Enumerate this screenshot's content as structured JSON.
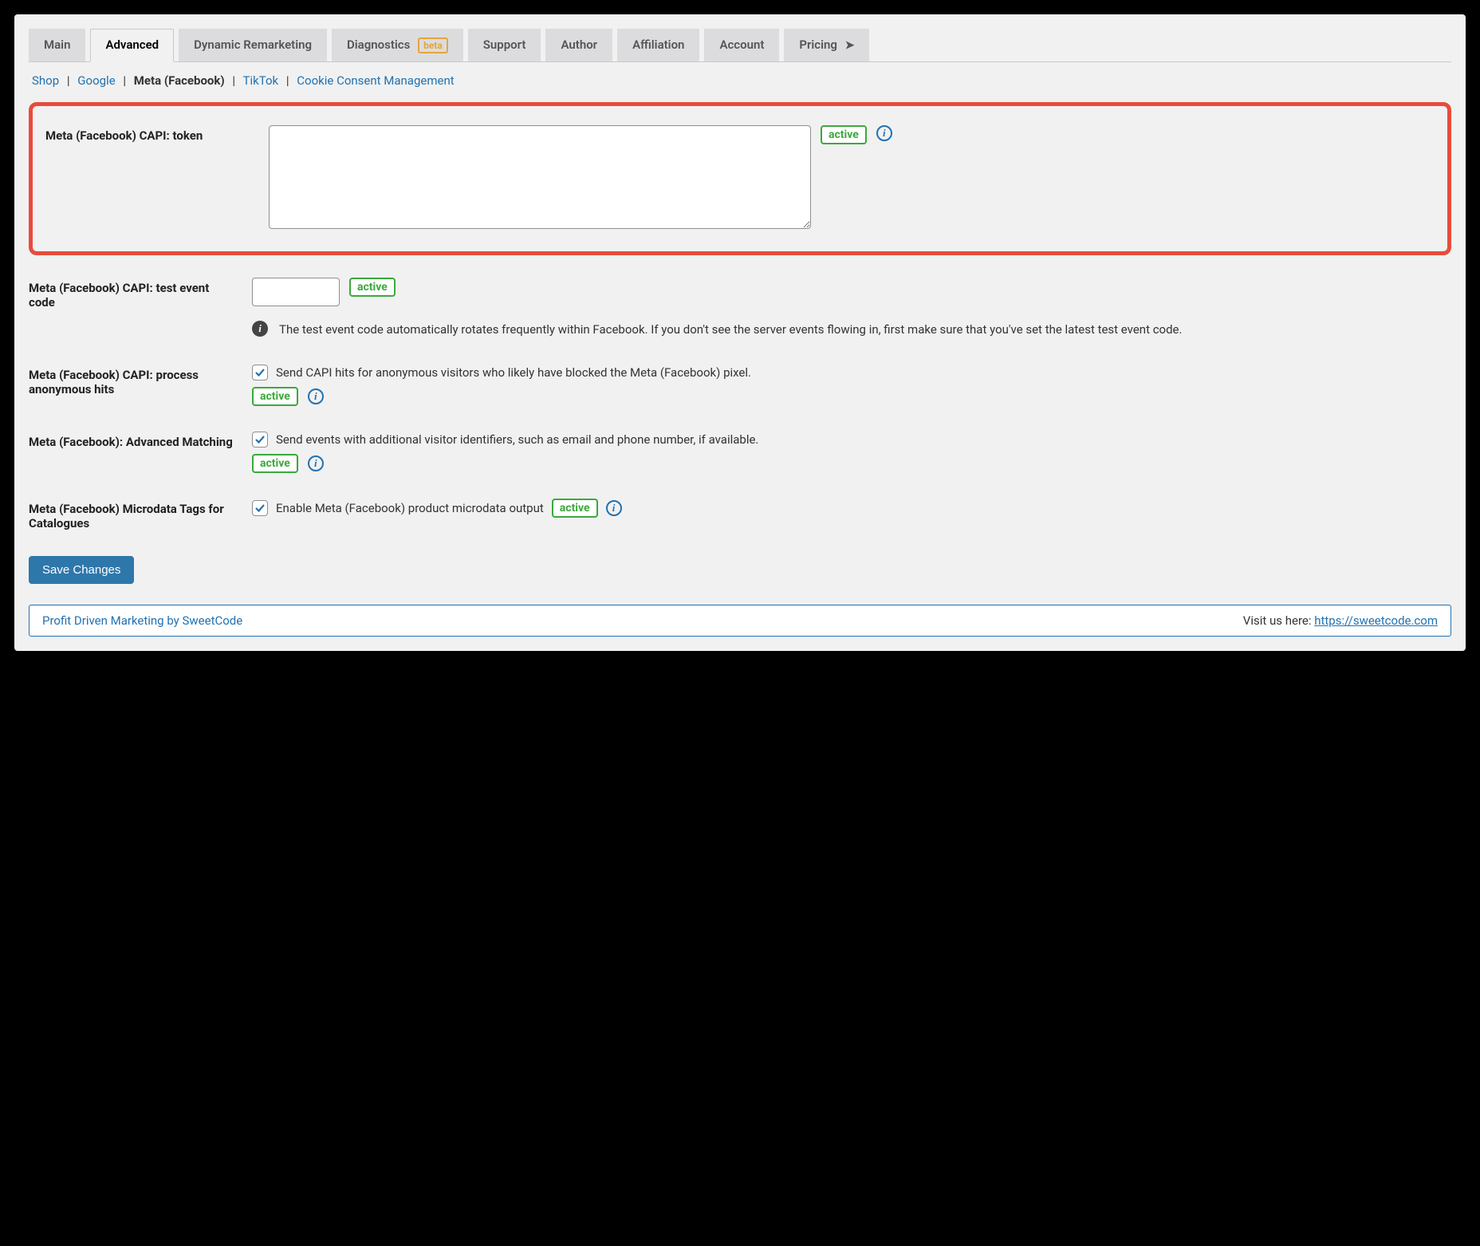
{
  "tabs": {
    "main": "Main",
    "advanced": "Advanced",
    "dynamic": "Dynamic Remarketing",
    "diagnostics": "Diagnostics",
    "diagnostics_beta": "beta",
    "support": "Support",
    "author": "Author",
    "affiliation": "Affiliation",
    "account": "Account",
    "pricing": "Pricing"
  },
  "subnav": {
    "shop": "Shop",
    "google": "Google",
    "meta": "Meta (Facebook)",
    "tiktok": "TikTok",
    "cookie": "Cookie Consent Management"
  },
  "section_token": {
    "label": "Meta (Facebook) CAPI: token",
    "value": "",
    "badge": "active"
  },
  "section_test": {
    "label": "Meta (Facebook) CAPI: test event code",
    "value": "",
    "badge": "active",
    "help": "The test event code automatically rotates frequently within Facebook. If you don't see the server events flowing in, first make sure that you've set the latest test event code."
  },
  "section_anon": {
    "label": "Meta (Facebook) CAPI: process anonymous hits",
    "checkbox_label": "Send CAPI hits for anonymous visitors who likely have blocked the Meta (Facebook) pixel.",
    "badge": "active"
  },
  "section_adv": {
    "label": "Meta (Facebook): Advanced Matching",
    "checkbox_label": "Send events with additional visitor identifiers, such as email and phone number, if available.",
    "badge": "active"
  },
  "section_microdata": {
    "label": "Meta (Facebook) Microdata Tags for Catalogues",
    "checkbox_label": "Enable Meta (Facebook) product microdata output",
    "badge": "active"
  },
  "save_label": "Save Changes",
  "footer": {
    "left": "Profit Driven Marketing by SweetCode",
    "right_prefix": "Visit us here: ",
    "right_link": "https://sweetcode.com"
  }
}
